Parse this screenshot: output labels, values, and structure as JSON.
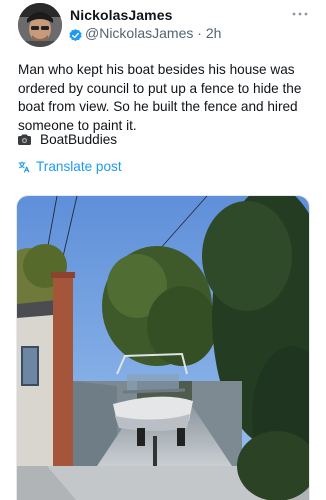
{
  "tweet": {
    "display_name": "NickolasJames",
    "handle": "@NickolasJames",
    "separator": "·",
    "time": "2h",
    "more_icon": "more-horizontal-icon",
    "body_lines": [
      "Man who kept his boat besides his house was",
      "ordered by council to put up a fence to hide the",
      "boat from view. So he built the fence and hired",
      "someone to paint it."
    ],
    "tag": "BoatBuddies",
    "translate_label": "Translate post",
    "colors": {
      "link": "#1d9bf0",
      "secondary_text": "#536471",
      "verified": "#1d9bf0"
    }
  }
}
